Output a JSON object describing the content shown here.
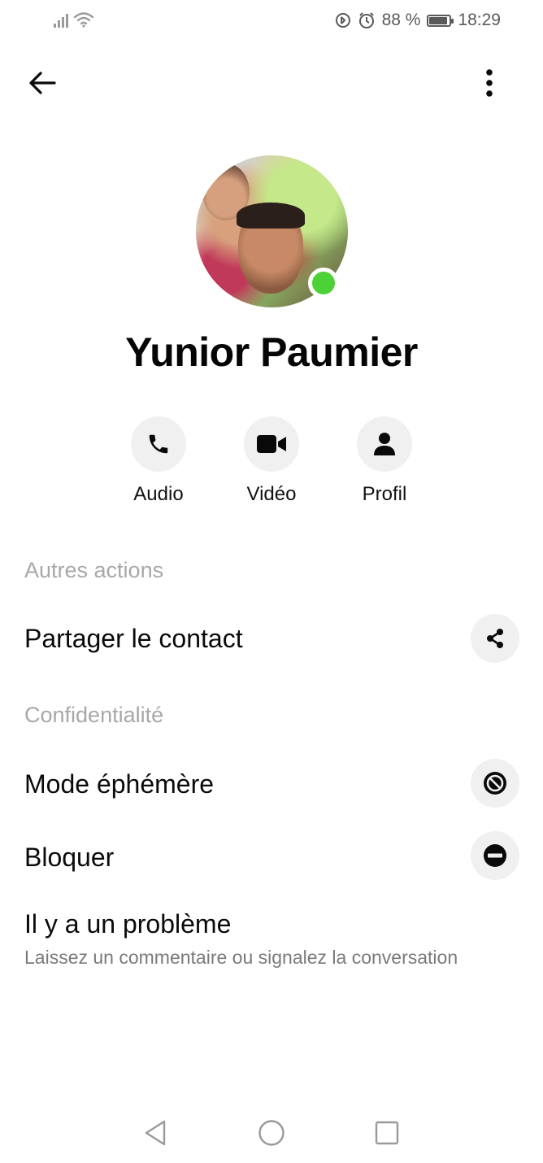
{
  "status_bar": {
    "battery_text": "88 %",
    "battery_level": 0.88,
    "time": "18:29",
    "icons": [
      "signal-icon",
      "wifi-icon",
      "data-saver-icon",
      "alarm-icon",
      "battery-icon"
    ]
  },
  "top_bar": {
    "back_icon": "arrow-left-icon",
    "more_icon": "more-vertical-icon"
  },
  "contact": {
    "name": "Yunior Paumier",
    "online": true,
    "online_color": "#4cd137"
  },
  "actions": [
    {
      "label": "Audio",
      "icon": "phone-icon"
    },
    {
      "label": "Vidéo",
      "icon": "video-camera-icon"
    },
    {
      "label": "Profil",
      "icon": "person-icon"
    }
  ],
  "sections": {
    "other_actions": {
      "title": "Autres actions",
      "items": [
        {
          "label": "Partager le contact",
          "icon": "share-icon"
        }
      ]
    },
    "privacy": {
      "title": "Confidentialité",
      "items": [
        {
          "label": "Mode éphémère",
          "icon": "vanish-mode-icon"
        },
        {
          "label": "Bloquer",
          "icon": "block-icon"
        },
        {
          "label": "Il y a un problème",
          "subtitle": "Laissez un commentaire ou signalez la conversation"
        }
      ]
    }
  },
  "nav_bar": {
    "icons": [
      "nav-back-icon",
      "nav-home-icon",
      "nav-recents-icon"
    ]
  },
  "colors": {
    "section_title": "#a8a8a8",
    "icon_circle": "#f0f0f0",
    "text": "#0a0a0a"
  }
}
